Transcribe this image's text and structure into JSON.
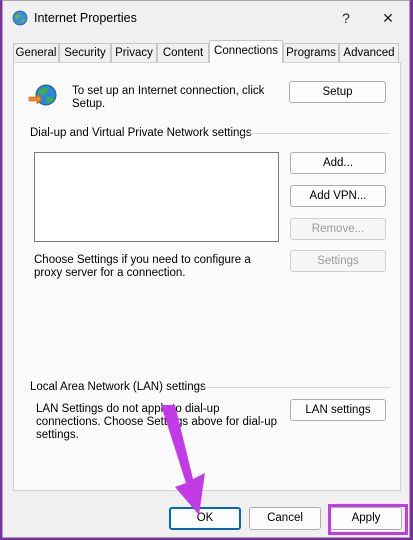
{
  "window": {
    "title": "Internet Properties",
    "help_symbol": "?",
    "close_symbol": "✕"
  },
  "tabs": [
    {
      "label": "General"
    },
    {
      "label": "Security"
    },
    {
      "label": "Privacy"
    },
    {
      "label": "Content"
    },
    {
      "label": "Connections",
      "active": true
    },
    {
      "label": "Programs"
    },
    {
      "label": "Advanced"
    }
  ],
  "setup": {
    "text": "To set up an Internet connection, click Setup.",
    "button": "Setup"
  },
  "vpn": {
    "group_label": "Dial-up and Virtual Private Network settings",
    "add_button": "Add...",
    "add_vpn_button": "Add VPN...",
    "remove_button": "Remove...",
    "settings_button": "Settings",
    "proxy_text": "Choose Settings if you need to configure a proxy server for a connection."
  },
  "lan": {
    "group_label": "Local Area Network (LAN) settings",
    "text": "LAN Settings do not apply to dial-up connections. Choose Settings above for dial-up settings.",
    "button": "LAN settings"
  },
  "footer": {
    "ok": "OK",
    "cancel": "Cancel",
    "apply": "Apply"
  },
  "colors": {
    "highlight": "#c23be6",
    "background": "#7a2fa0",
    "focus": "#0067c0"
  },
  "icons": [
    "globe-icon",
    "network-setup-icon",
    "arrow-pointer"
  ]
}
